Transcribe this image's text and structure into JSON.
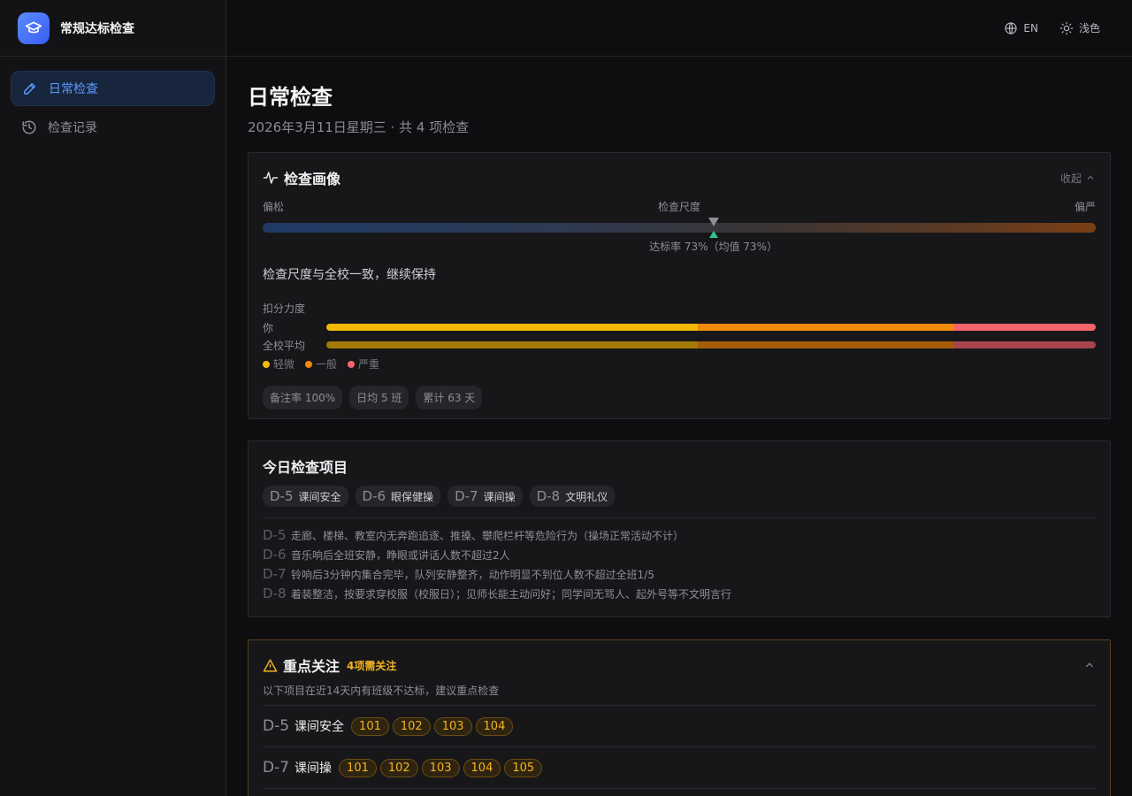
{
  "app": {
    "title": "常规达标检查"
  },
  "nav": {
    "items": [
      {
        "label": "日常检查",
        "active": true,
        "icon": "pencil-icon"
      },
      {
        "label": "检查记录",
        "active": false,
        "icon": "history-icon"
      }
    ]
  },
  "topbar": {
    "lang_label": "EN",
    "theme_label": "浅色"
  },
  "page": {
    "title": "日常检查",
    "subtitle": "2026年3月11日星期三 · 共 4 项检查"
  },
  "profile": {
    "title": "检查画像",
    "collapse_label": "收起",
    "scale": {
      "left_label": "偏松",
      "center_label": "检查尺度",
      "right_label": "偏严",
      "average_marker": 0.541,
      "rate_marker": 0.541,
      "note": "达标率 73%（均值 73%）"
    },
    "advice": "检查尺度与全校一致，继续保持",
    "deduction": {
      "title": "扣分力度",
      "rows": [
        {
          "label": "你",
          "segments": [
            0.483,
            0.332,
            0.185
          ]
        },
        {
          "label": "全校平均",
          "segments": [
            0.483,
            0.332,
            0.185
          ]
        }
      ],
      "legend": [
        "轻微",
        "一般",
        "严重"
      ],
      "colors": [
        "#f5b800",
        "#f28a0c",
        "#f2656a"
      ],
      "avg_colors": [
        "#a67a08",
        "#a65d08",
        "#a8454c"
      ]
    },
    "stats": [
      "备注率 100%",
      "日均 5 班",
      "累计 63 天"
    ]
  },
  "today": {
    "title": "今日检查项目",
    "items": [
      {
        "code": "D-5",
        "name": "课间安全",
        "desc": "走廊、楼梯、教室内无奔跑追逐、推搡、攀爬栏杆等危险行为（操场正常活动不计）"
      },
      {
        "code": "D-6",
        "name": "眼保健操",
        "desc": "音乐响后全班安静，睁眼或讲话人数不超过2人"
      },
      {
        "code": "D-7",
        "name": "课间操",
        "desc": "铃响后3分钟内集合完毕，队列安静整齐，动作明显不到位人数不超过全班1/5"
      },
      {
        "code": "D-8",
        "name": "文明礼仪",
        "desc": "着装整洁，按要求穿校服（校服日）；见师长能主动问好；同学间无骂人、起外号等不文明言行"
      }
    ]
  },
  "focus": {
    "title": "重点关注",
    "badge": "4项需关注",
    "desc": "以下项目在近14天内有班级不达标，建议重点检查",
    "rows": [
      {
        "code": "D-5",
        "name": "课间安全",
        "classes": [
          "101",
          "102",
          "103",
          "104"
        ]
      },
      {
        "code": "D-7",
        "name": "课间操",
        "classes": [
          "101",
          "102",
          "103",
          "104",
          "105"
        ]
      }
    ]
  }
}
